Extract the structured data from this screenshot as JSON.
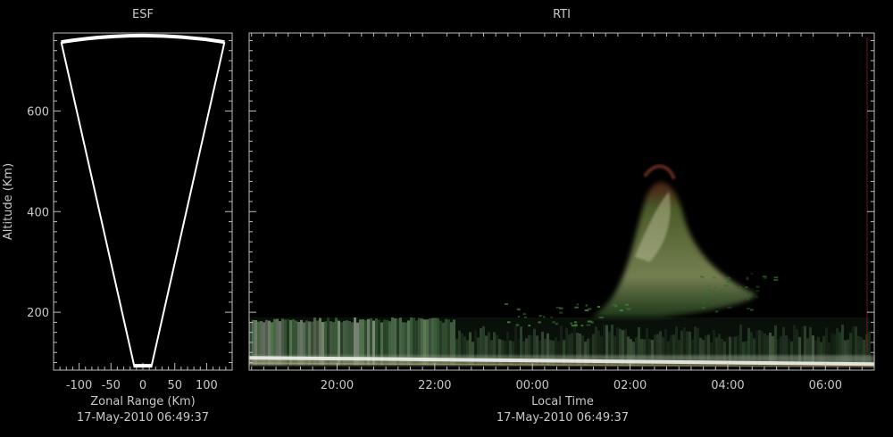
{
  "chart_data": [
    {
      "type": "scatter",
      "title": "ESF",
      "xlabel": "Zonal Range (Km)",
      "ylabel": "Altitude (Km)",
      "timestamp": "17-May-2010 06:49:37",
      "xlim": [
        -140,
        140
      ],
      "ylim": [
        85,
        755
      ],
      "x_ticks": [
        -100,
        -50,
        0,
        50,
        100
      ],
      "y_ticks": [
        200,
        400,
        600
      ],
      "beam_outline": {
        "apex": [
          0,
          90
        ],
        "near_edge": [
          [
            -13,
            90
          ],
          [
            13,
            90
          ]
        ],
        "far_edge": [
          [
            -128,
            737
          ],
          [
            -60,
            750
          ],
          [
            0,
            752
          ],
          [
            60,
            750
          ],
          [
            128,
            737
          ]
        ]
      },
      "grid": false
    },
    {
      "type": "heatmap",
      "title": "RTI",
      "xlabel": "Local Time",
      "timestamp": "17-May-2010 06:49:37",
      "x_tick_labels": [
        "20:00",
        "22:00",
        "00:00",
        "02:00",
        "04:00",
        "06:00"
      ],
      "x_ticks_hours_since_20": [
        0,
        2,
        4,
        6,
        8,
        10
      ],
      "xlim_hours_since_20": [
        -1.8,
        11.0
      ],
      "ylim": [
        85,
        755
      ],
      "y_ticks": [
        200,
        400,
        600
      ],
      "grid": false,
      "features": [
        {
          "name": "bottomside layer",
          "t_start": -1.8,
          "t_end": 10.9,
          "alt_low": 95,
          "alt_high": 190,
          "color": "#6a8a6a"
        },
        {
          "name": "bright trace",
          "t_start": -1.8,
          "t_end": 11.0,
          "alt_low": 98,
          "alt_high": 110,
          "color": "#e8ece0"
        },
        {
          "name": "plume",
          "t_start": 5.7,
          "t_end": 8.8,
          "alt_low": 170,
          "alt_high": 495,
          "color": "#7c9a56"
        }
      ]
    }
  ]
}
